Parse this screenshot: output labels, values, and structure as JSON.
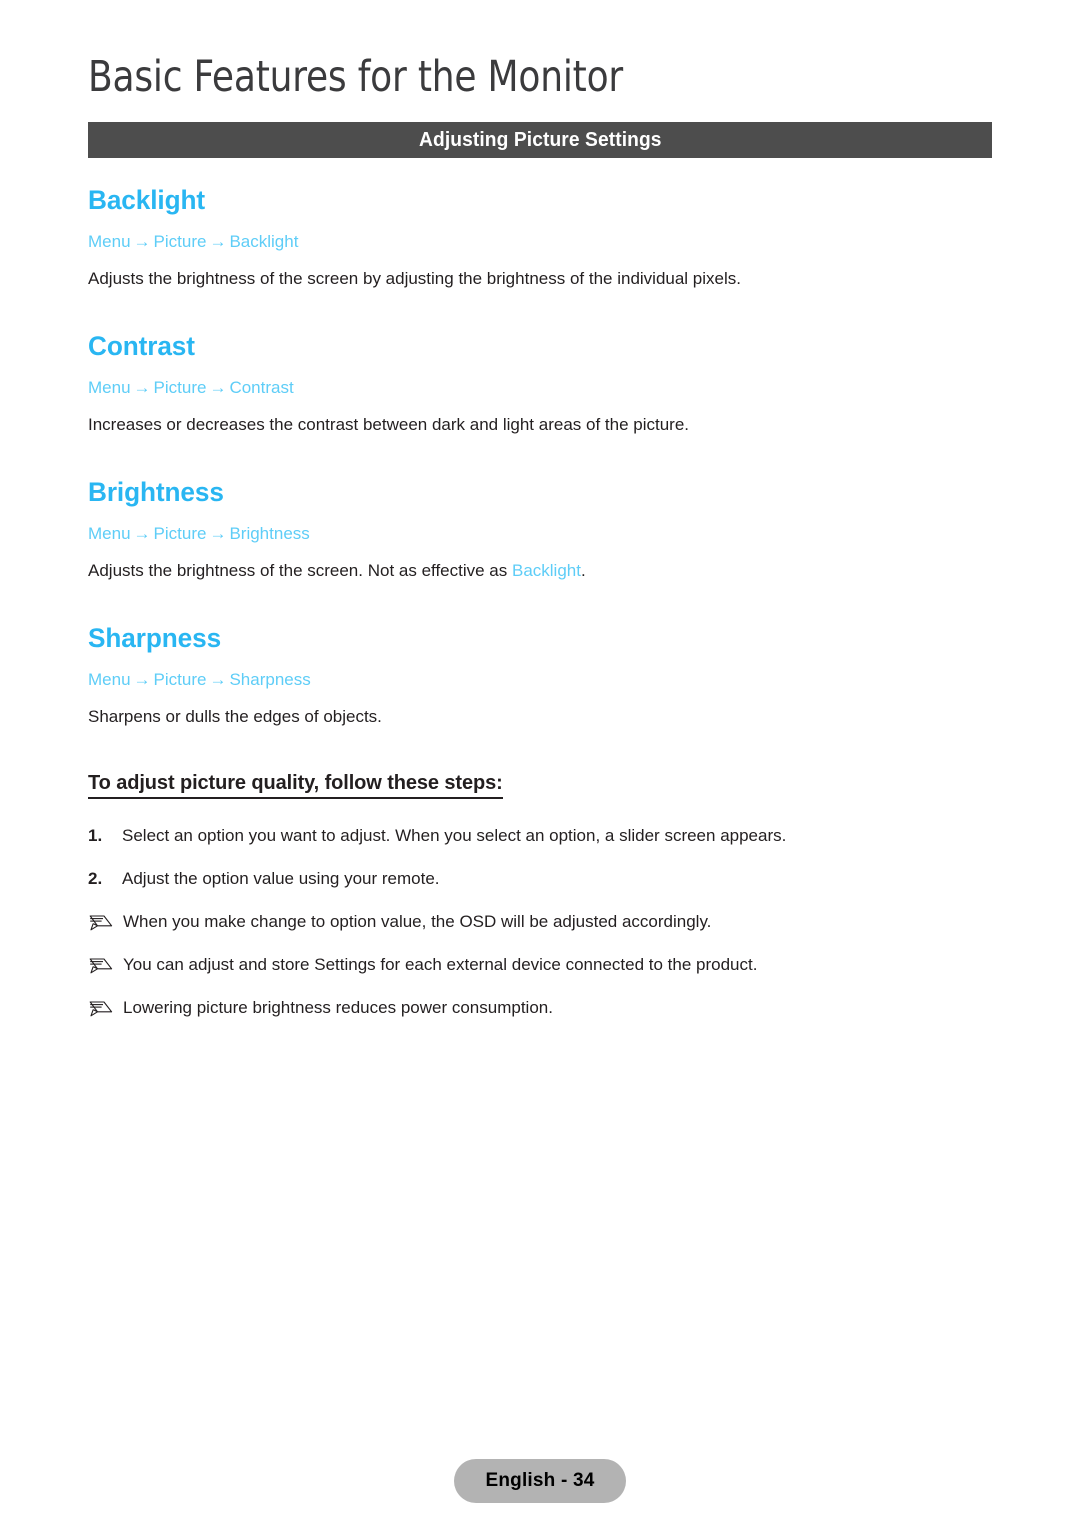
{
  "document": {
    "page_title": "Basic Features for the Monitor",
    "section_bar_label": "Adjusting Picture Settings"
  },
  "sections": [
    {
      "heading": "Backlight",
      "breadcrumb": {
        "menu": "Menu",
        "level2": "Picture",
        "level3": "Backlight",
        "arrow": "→"
      },
      "description": "Adjusts the brightness of the screen by adjusting the brightness of the individual pixels."
    },
    {
      "heading": "Contrast",
      "breadcrumb": {
        "menu": "Menu",
        "level2": "Picture",
        "level3": "Contrast",
        "arrow": "→"
      },
      "description": "Increases or decreases the contrast between dark and light areas of the picture."
    },
    {
      "heading": "Brightness",
      "breadcrumb": {
        "menu": "Menu",
        "level2": "Picture",
        "level3": "Brightness",
        "arrow": "→"
      },
      "description_prefix": "Adjusts the brightness of the screen. Not as effective as ",
      "description_link": "Backlight",
      "description_suffix": "."
    },
    {
      "heading": "Sharpness",
      "breadcrumb": {
        "menu": "Menu",
        "level2": "Picture",
        "level3": "Sharpness",
        "arrow": "→"
      },
      "description": "Sharpens or dulls the edges of objects."
    }
  ],
  "steps_block": {
    "heading": "To adjust picture quality, follow these steps:",
    "steps": [
      {
        "number": "1.",
        "text": "Select an option you want to adjust. When you select an option, a slider screen appears."
      },
      {
        "number": "2.",
        "text": "Adjust the option value using your remote."
      }
    ],
    "notes": [
      {
        "icon": "pencil-note-icon",
        "text": "When you make change to option value, the OSD will be adjusted accordingly."
      },
      {
        "icon": "pencil-note-icon",
        "text": "You can adjust and store Settings for each external device connected to the product."
      },
      {
        "icon": "pencil-note-icon",
        "text": "Lowering picture brightness reduces power consumption."
      }
    ]
  },
  "footer": {
    "page_label": "English - 34"
  },
  "colors": {
    "heading_blue": "#29b6f2",
    "breadcrumb_blue": "#5ecdf7",
    "section_bar_bg": "#4d4d4d",
    "body_text": "#231f20",
    "footer_pill_bg": "#b3b3b3",
    "page_bg": "#ffffff"
  }
}
